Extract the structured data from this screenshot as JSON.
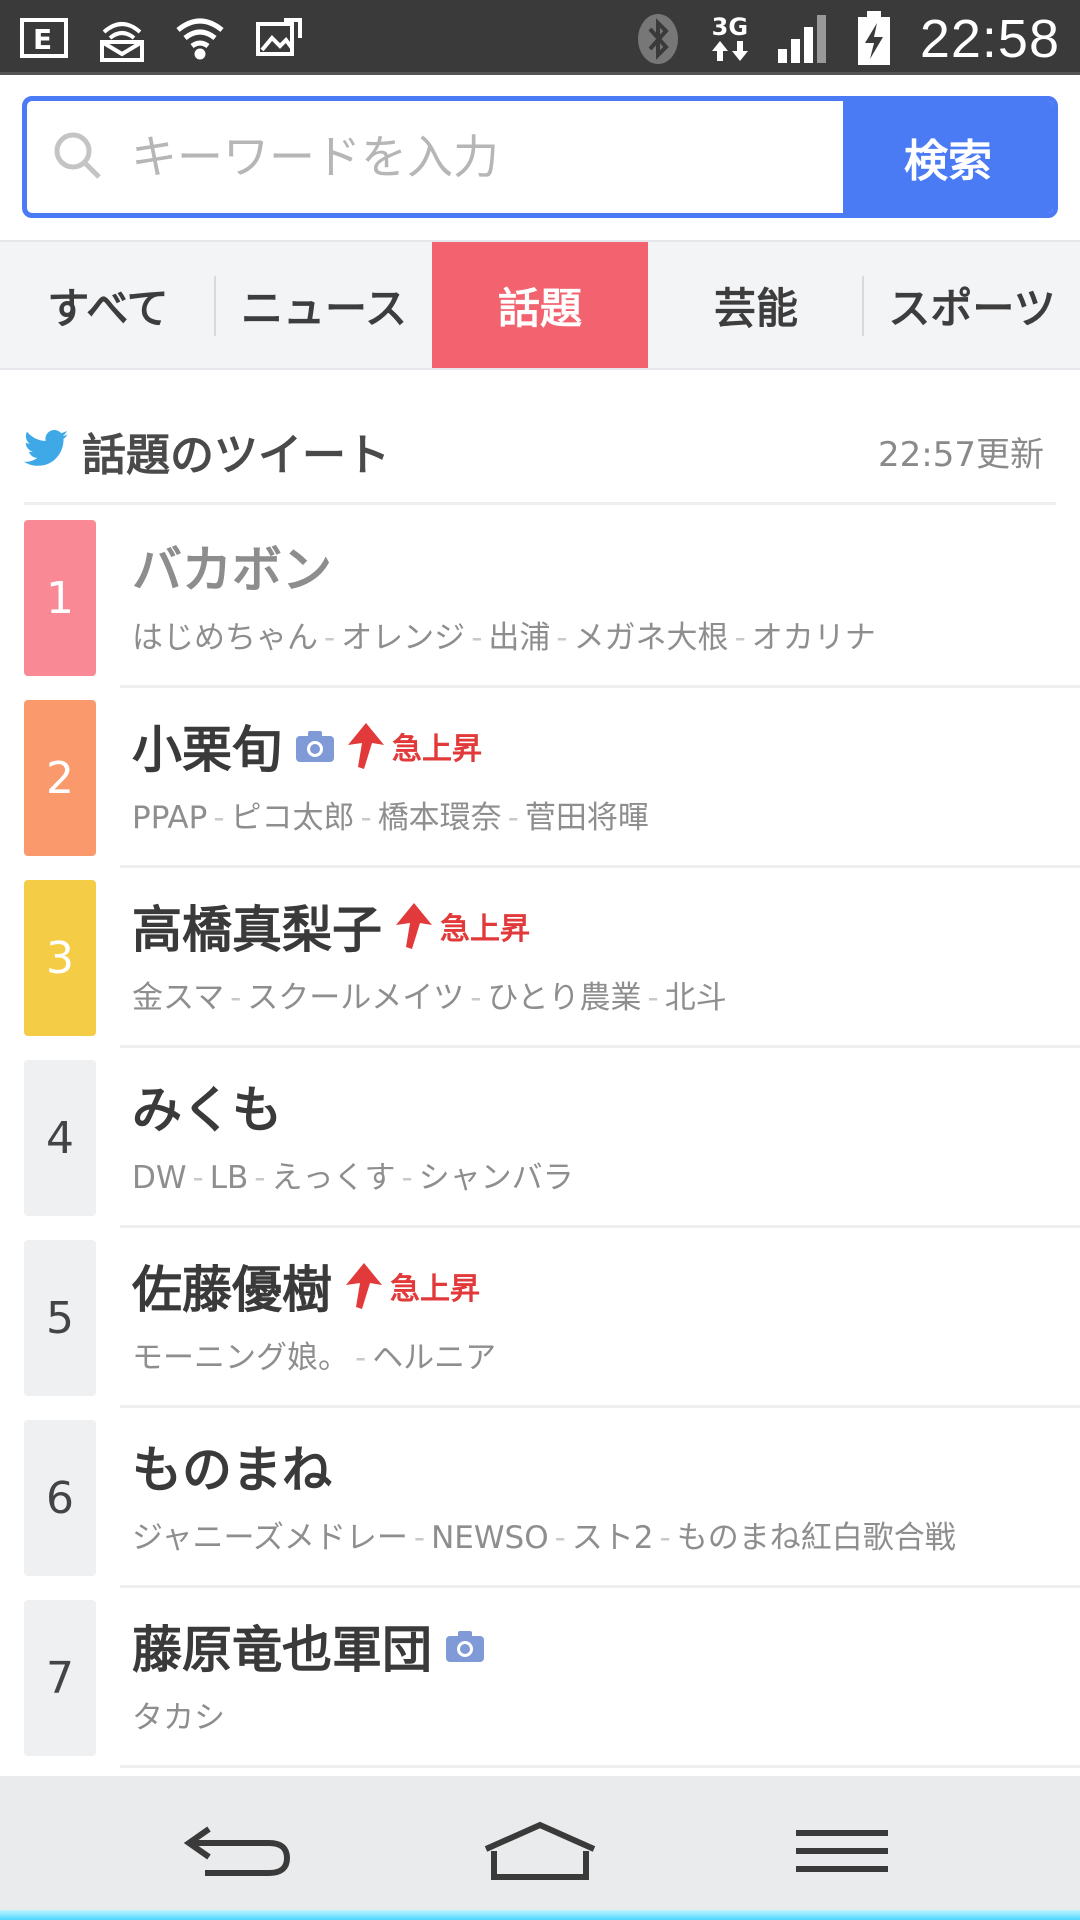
{
  "status_bar": {
    "time": "22:58",
    "network_type": "3G",
    "icons": [
      "email-icon",
      "wifi-hotspot-icon",
      "wifi-icon",
      "image-icon",
      "bluetooth-icon",
      "network-3g-icon",
      "signal-icon",
      "battery-charging-icon"
    ]
  },
  "search": {
    "placeholder": "キーワードを入力",
    "button_label": "検索"
  },
  "tabs": [
    {
      "label": "すべて",
      "active": false
    },
    {
      "label": "ニュース",
      "active": false
    },
    {
      "label": "話題",
      "active": true
    },
    {
      "label": "芸能",
      "active": false
    },
    {
      "label": "スポーツ",
      "active": false
    }
  ],
  "section": {
    "title": "話題のツイート",
    "updated": "22:57更新"
  },
  "colors": {
    "accent_blue": "#4a7bf5",
    "active_tab": "#f2626f",
    "rank1": "#f98995",
    "rank2": "#fa9a6c",
    "rank3": "#f5cc45",
    "rank_other": "#eef0f2",
    "surge_red": "#e23a3a",
    "twitter_blue": "#3fa9e8"
  },
  "rankings": [
    {
      "rank": "1",
      "title": "バカボン",
      "camera": false,
      "surge": false,
      "related": [
        "はじめちゃん",
        "オレンジ",
        "出浦",
        "メガネ大根",
        "オカリナ"
      ]
    },
    {
      "rank": "2",
      "title": "小栗旬",
      "camera": true,
      "surge": true,
      "related": [
        "PPAP",
        "ピコ太郎",
        "橋本環奈",
        "菅田将暉"
      ]
    },
    {
      "rank": "3",
      "title": "高橋真梨子",
      "camera": false,
      "surge": true,
      "related": [
        "金スマ",
        "スクールメイツ",
        "ひとり農業",
        "北斗"
      ]
    },
    {
      "rank": "4",
      "title": "みくも",
      "camera": false,
      "surge": false,
      "related": [
        "DW",
        "LB",
        "えっくす",
        "シャンバラ"
      ]
    },
    {
      "rank": "5",
      "title": "佐藤優樹",
      "camera": false,
      "surge": true,
      "related": [
        "モーニング娘。",
        "ヘルニア"
      ]
    },
    {
      "rank": "6",
      "title": "ものまね",
      "camera": false,
      "surge": false,
      "related": [
        "ジャニーズメドレー",
        "NEWSO",
        "スト2",
        "ものまね紅白歌合戦"
      ]
    },
    {
      "rank": "7",
      "title": "藤原竜也軍団",
      "camera": true,
      "surge": false,
      "related": [
        "タカシ"
      ]
    }
  ],
  "surge_label": "急上昇",
  "nav": {
    "icons": [
      "back-icon",
      "home-icon",
      "menu-icon"
    ]
  }
}
